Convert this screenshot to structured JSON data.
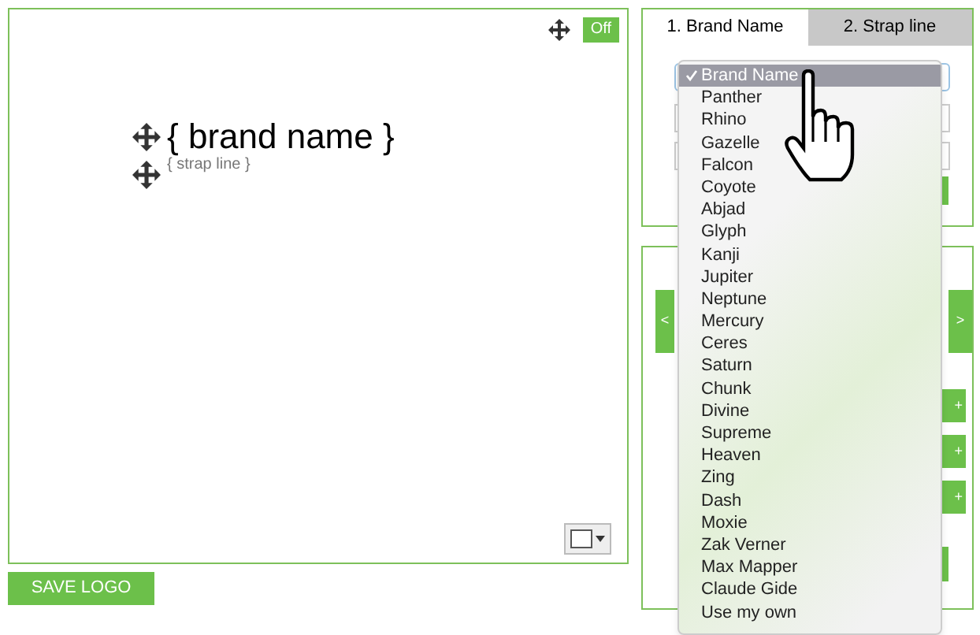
{
  "canvas": {
    "toggle": "Off",
    "brand_name": "{ brand name }",
    "strap_line": "{ strap line }"
  },
  "save_button": "SAVE LOGO",
  "tabs": [
    {
      "label": "1. Brand Name",
      "selected": true
    },
    {
      "label": "2. Strap line",
      "selected": false
    }
  ],
  "controls": {
    "prev": "<",
    "next": ">",
    "add_buttons": [
      "+",
      "+",
      "+"
    ]
  },
  "font_menu": {
    "items": [
      {
        "label": "Brand Name",
        "selected": true
      },
      {
        "label": "Panther",
        "selected": false
      },
      {
        "label": "Rhino",
        "selected": false
      },
      {
        "label": "Gazelle",
        "selected": false
      },
      {
        "label": "Falcon",
        "selected": false
      },
      {
        "label": "Coyote",
        "selected": false
      },
      {
        "label": "Abjad",
        "selected": false
      },
      {
        "label": "Glyph",
        "selected": false
      },
      {
        "label": "Kanji",
        "selected": false
      },
      {
        "label": "Jupiter",
        "selected": false
      },
      {
        "label": "Neptune",
        "selected": false
      },
      {
        "label": "Mercury",
        "selected": false
      },
      {
        "label": "Ceres",
        "selected": false
      },
      {
        "label": "Saturn",
        "selected": false
      },
      {
        "label": "Chunk",
        "selected": false
      },
      {
        "label": "Divine",
        "selected": false
      },
      {
        "label": "Supreme",
        "selected": false
      },
      {
        "label": "Heaven",
        "selected": false
      },
      {
        "label": "Zing",
        "selected": false
      },
      {
        "label": "Dash",
        "selected": false
      },
      {
        "label": "Moxie",
        "selected": false
      },
      {
        "label": "Zak Verner",
        "selected": false
      },
      {
        "label": "Max Mapper",
        "selected": false
      },
      {
        "label": "Claude Gide",
        "selected": false
      },
      {
        "label": "Use my own",
        "selected": false
      }
    ]
  }
}
